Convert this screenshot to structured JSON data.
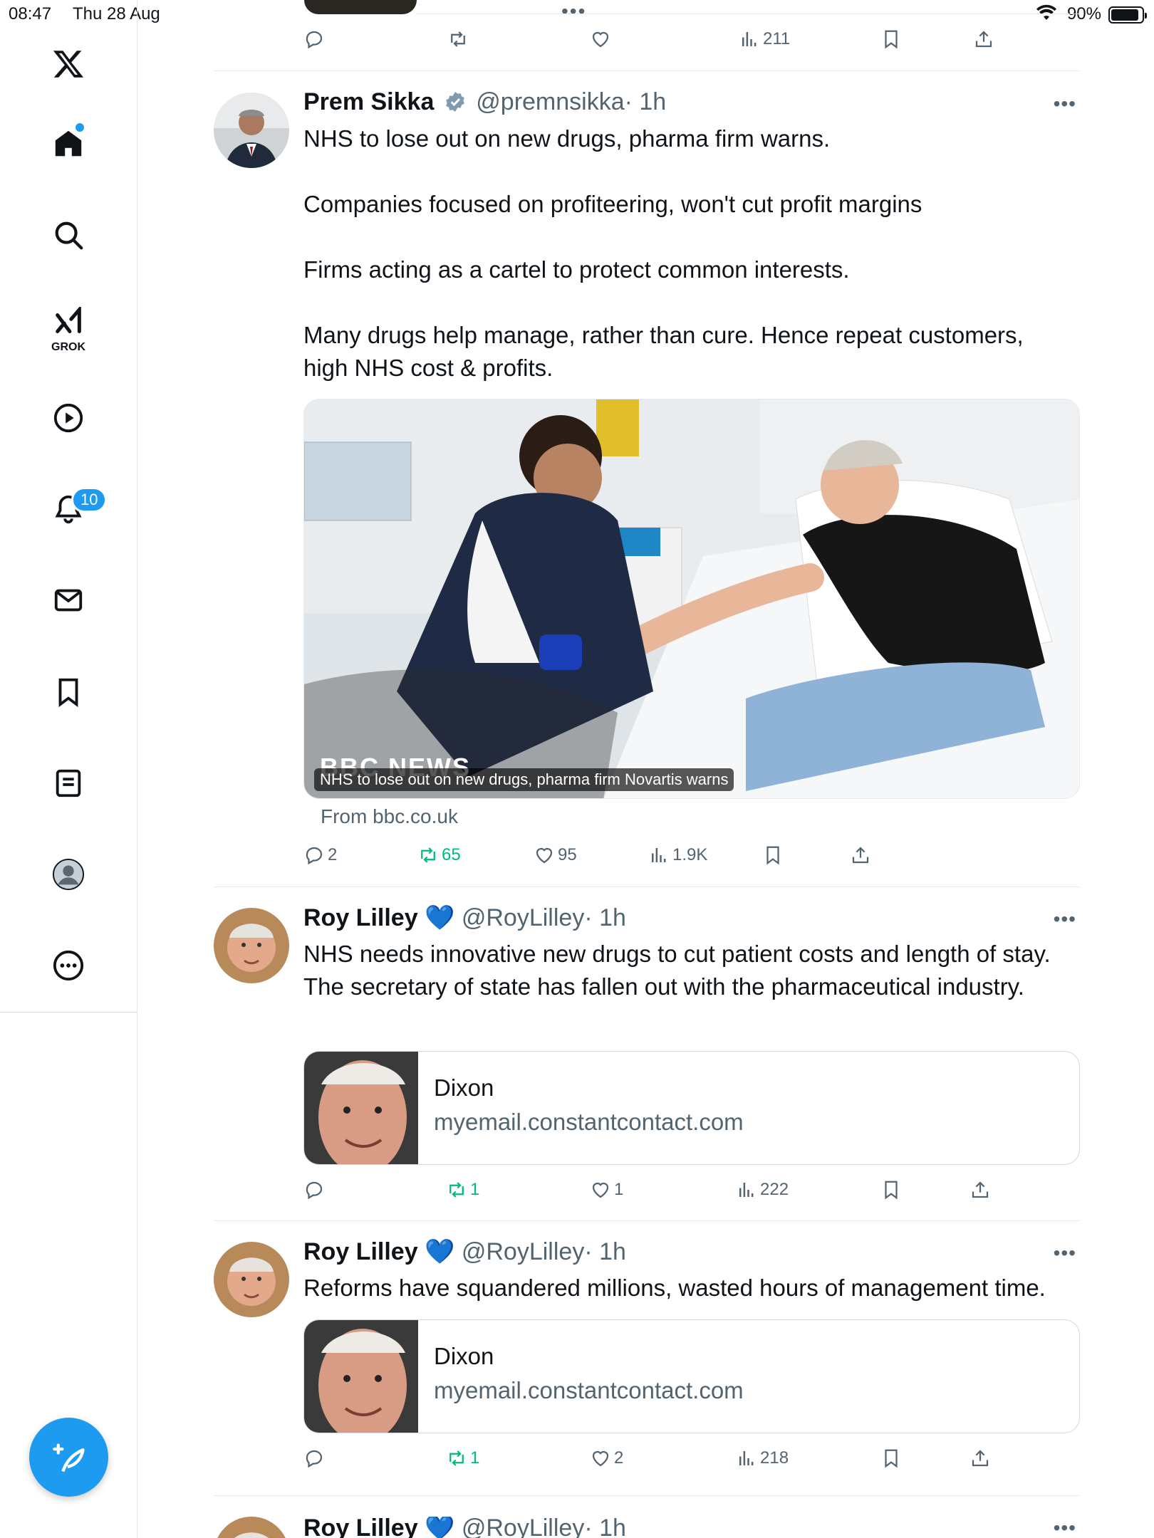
{
  "status": {
    "time": "08:47",
    "date": "Thu 28 Aug",
    "battery": "90%",
    "battery_level": 0.9,
    "dots": "•••"
  },
  "sidebar": {
    "grok_label": "GROK",
    "notifications_badge": "10",
    "items": [
      "home-icon",
      "search-icon",
      "grok-icon",
      "video-icon",
      "notifications-icon",
      "messages-icon",
      "bookmarks-icon",
      "lists-icon",
      "profile-icon",
      "more-icon"
    ]
  },
  "top_actions": {
    "views": "211"
  },
  "tweets": [
    {
      "name": "Prem Sikka",
      "handle": "@premnsikka",
      "time": "· 1h",
      "verified": "blue-check",
      "text": [
        "NHS to lose out on new drugs, pharma firm warns.",
        "Companies focused on profiteering, won't cut profit margins",
        "Firms acting as a cartel to protect common interests.",
        "Many drugs help manage, rather than cure. Hence repeat customers, high NHS cost & profits."
      ],
      "media_caption": "NHS to lose out on new drugs, pharma firm Novartis warns",
      "media_logo": "BBC NEWS",
      "from": "From bbc.co.uk",
      "replies": "2",
      "reposts": "65",
      "likes": "95",
      "views": "1.9K"
    },
    {
      "name": "Roy Lilley",
      "emoji": "💙",
      "handle": "@RoyLilley",
      "time": "· 1h",
      "text": "NHS needs innovative new drugs to cut patient costs and length of stay. The secretary of state has fallen out with the pharmaceutical industry.",
      "card_title": "Dixon",
      "card_domain": "myemail.constantcontact.com",
      "replies": "",
      "reposts": "1",
      "likes": "1",
      "views": "222"
    },
    {
      "name": "Roy Lilley",
      "emoji": "💙",
      "handle": "@RoyLilley",
      "time": "· 1h",
      "text": "Reforms have squandered millions, wasted hours of management time.",
      "card_title": "Dixon",
      "card_domain": "myemail.constantcontact.com",
      "replies": "",
      "reposts": "1",
      "likes": "2",
      "views": "218"
    },
    {
      "name": "Roy Lilley",
      "emoji": "💙",
      "handle": "@RoyLilley",
      "time": "· 1h"
    }
  ],
  "colors": {
    "accent": "#1d9bf0",
    "repost_green": "#00ba7c",
    "muted": "#536471"
  }
}
